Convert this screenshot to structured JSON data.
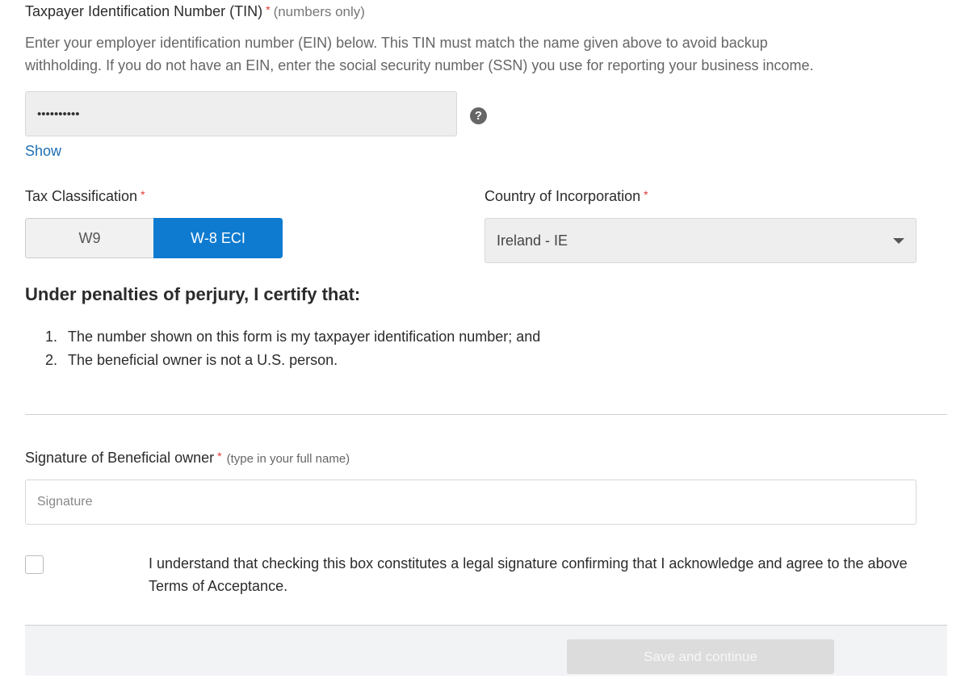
{
  "tin": {
    "label": "Taxpayer Identification Number (TIN)",
    "required_mark": "*",
    "hint": "(numbers only)",
    "description_line1": "Enter your employer identification number (EIN) below. This TIN must match the name given above to avoid backup",
    "description_line2": "withholding. If you do not have an EIN, enter the social security number (SSN) you use for reporting your business income.",
    "masked_value": "••••••••••",
    "help_icon": "question-circle-icon",
    "show_link": "Show"
  },
  "tax_classification": {
    "label": "Tax Classification",
    "required_mark": "*",
    "options": [
      "W9",
      "W-8 ECI"
    ],
    "selected": "W-8 ECI"
  },
  "country": {
    "label": "Country of Incorporation",
    "required_mark": "*",
    "value": "Ireland - IE"
  },
  "certification": {
    "heading": "Under penalties of perjury, I certify that:",
    "items": [
      {
        "num": "1.",
        "text": "The number shown on this form is my taxpayer identification number; and"
      },
      {
        "num": "2.",
        "text": "The beneficial owner is not a U.S. person."
      }
    ]
  },
  "signature": {
    "label": "Signature of Beneficial owner",
    "required_mark": "*",
    "hint": "(type in your full name)",
    "placeholder": "Signature"
  },
  "consent": {
    "text": "I understand that checking this box constitutes a legal signature confirming that I acknowledge and agree to the above Terms of Acceptance.",
    "checked": false
  },
  "footer": {
    "save_label": "Save and continue"
  },
  "colors": {
    "accent": "#0e7bd0",
    "required": "#e53935",
    "link": "#1f6fb5"
  }
}
